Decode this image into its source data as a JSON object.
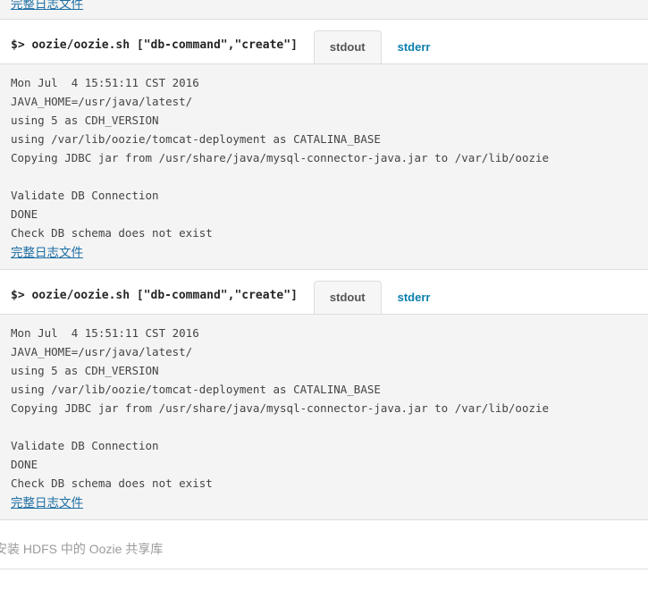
{
  "top_partial": {
    "full_log_link": "完整日志文件"
  },
  "log_blocks": [
    {
      "command": "$> oozie/oozie.sh [\"db-command\",\"create\"]",
      "tabs": [
        {
          "label": "stdout",
          "active": true
        },
        {
          "label": "stderr",
          "active": false
        }
      ],
      "lines": [
        "Mon Jul  4 15:51:11 CST 2016",
        "JAVA_HOME=/usr/java/latest/",
        "using 5 as CDH_VERSION",
        "using /var/lib/oozie/tomcat-deployment as CATALINA_BASE",
        "Copying JDBC jar from /usr/share/java/mysql-connector-java.jar to /var/lib/oozie",
        "",
        "Validate DB Connection",
        "DONE",
        "Check DB schema does not exist"
      ],
      "full_log_link": "完整日志文件"
    },
    {
      "command": "$> oozie/oozie.sh [\"db-command\",\"create\"]",
      "tabs": [
        {
          "label": "stdout",
          "active": true
        },
        {
          "label": "stderr",
          "active": false
        }
      ],
      "lines": [
        "Mon Jul  4 15:51:11 CST 2016",
        "JAVA_HOME=/usr/java/latest/",
        "using 5 as CDH_VERSION",
        "using /var/lib/oozie/tomcat-deployment as CATALINA_BASE",
        "Copying JDBC jar from /usr/share/java/mysql-connector-java.jar to /var/lib/oozie",
        "",
        "Validate DB Connection",
        "DONE",
        "Check DB schema does not exist"
      ],
      "full_log_link": "完整日志文件"
    }
  ],
  "footer": {
    "step_label": "安装 HDFS 中的 Oozie 共享库"
  },
  "colors": {
    "link": "#1c6ea4",
    "tab_inactive": "#0b7fad",
    "log_background": "#f4f4f4",
    "border": "#dddddd",
    "footer_text": "#9b9b9b"
  }
}
